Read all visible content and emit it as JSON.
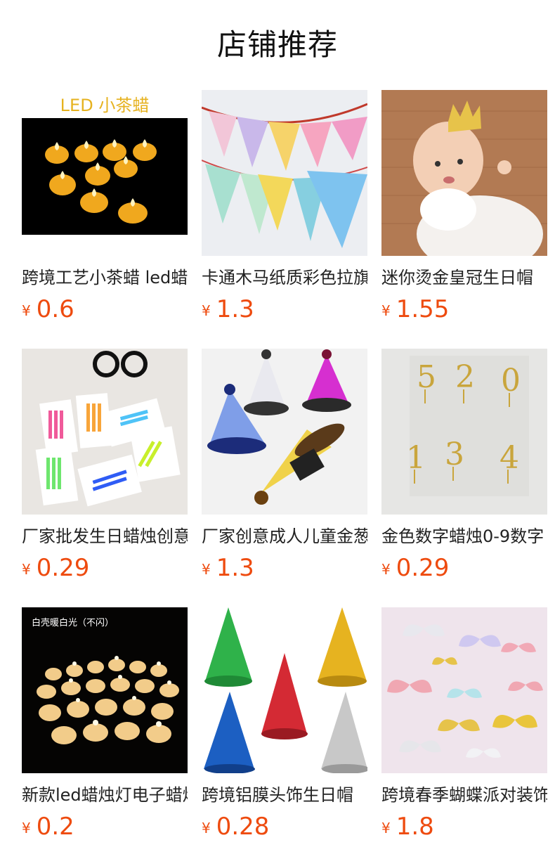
{
  "section": {
    "title": "店铺推荐"
  },
  "currency_symbol": "¥",
  "products": [
    {
      "name": "跨境工艺小茶蜡 led蜡烛",
      "price": "0.6",
      "image_caption": "LED 小茶蜡",
      "image": "led-tealight-candles"
    },
    {
      "name": "卡通木马纸质彩色拉旗",
      "price": "1.3",
      "image_caption": "",
      "image": "pennant-banner-flags"
    },
    {
      "name": "迷你烫金皇冠生日帽",
      "price": "1.55",
      "image_caption": "",
      "image": "baby-gold-crown"
    },
    {
      "name": "厂家批发生日蜡烛创意",
      "price": "0.29",
      "image_caption": "",
      "image": "colored-birthday-candles"
    },
    {
      "name": "厂家创意成人儿童金葱",
      "price": "1.3",
      "image_caption": "",
      "image": "glitter-party-hats"
    },
    {
      "name": "金色数字蜡烛0-9数字",
      "price": "0.29",
      "image_caption": "",
      "image": "gold-number-candles"
    },
    {
      "name": "新款led蜡烛灯电子蜡烛",
      "price": "0.2",
      "image_caption": "白壳暖白光（不闪）",
      "image": "led-candle-lights"
    },
    {
      "name": "跨境铝膜头饰生日帽",
      "price": "0.28",
      "image_caption": "",
      "image": "foil-cone-hats"
    },
    {
      "name": "跨境春季蝴蝶派对装饰",
      "price": "1.8",
      "image_caption": "",
      "image": "paper-butterflies"
    }
  ]
}
